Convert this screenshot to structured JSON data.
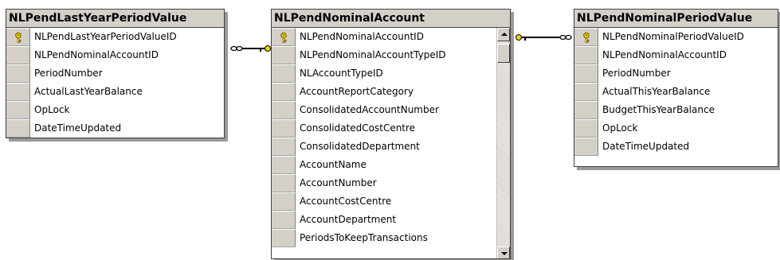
{
  "tables": {
    "last_year": {
      "title": "NLPendLastYearPeriodValue",
      "columns": [
        "NLPendLastYearPeriodValueID",
        "NLPendNominalAccountID",
        "PeriodNumber",
        "ActualLastYearBalance",
        "OpLock",
        "DateTimeUpdated"
      ],
      "primary_key_index": 0
    },
    "nominal_account": {
      "title": "NLPendNominalAccount",
      "columns": [
        "NLPendNominalAccountID",
        "NLPendNominalAccountTypeID",
        "NLAccountTypeID",
        "AccountReportCategory",
        "ConsolidatedAccountNumber",
        "ConsolidatedCostCentre",
        "ConsolidatedDepartment",
        "AccountName",
        "AccountNumber",
        "AccountCostCentre",
        "AccountDepartment",
        "PeriodsToKeepTransactions"
      ],
      "primary_key_index": 0
    },
    "period_value": {
      "title": "NLPendNominalPeriodValue",
      "columns": [
        "NLPendNominalPeriodValueID",
        "NLPendNominalAccountID",
        "PeriodNumber",
        "ActualThisYearBalance",
        "BudgetThisYearBalance",
        "OpLock",
        "DateTimeUpdated"
      ],
      "primary_key_index": 0
    }
  },
  "icons": {
    "primary_key": "key-icon",
    "relationship_one": "key-end-icon",
    "relationship_many": "infinity-end-icon",
    "scroll_up": "scroll-up-arrow",
    "scroll_down": "scroll-down-arrow"
  },
  "colors": {
    "header_bg": "#d4d0c8",
    "border": "#404040",
    "key_yellow": "#e8c800",
    "shadow": "#9a9a9a"
  }
}
